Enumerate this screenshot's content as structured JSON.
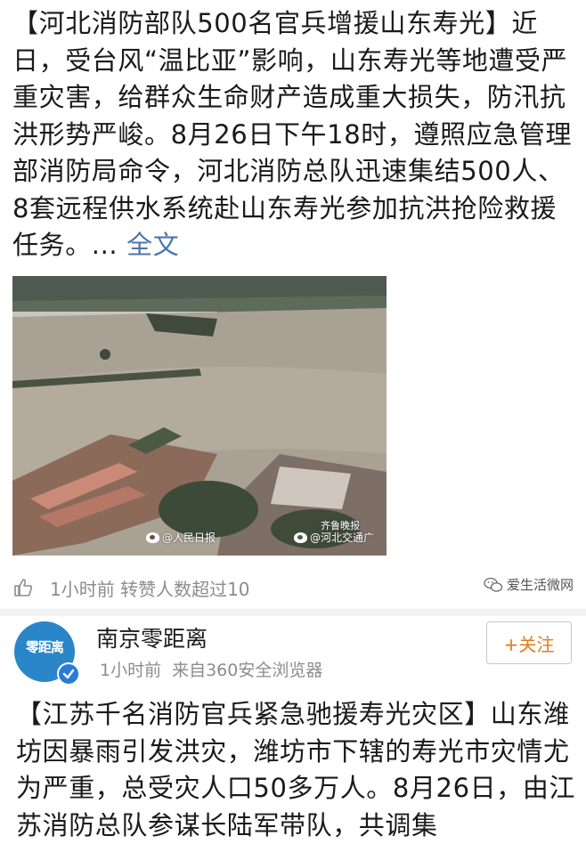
{
  "post1": {
    "text": "【河北消防部队500名官兵增援山东寿光】近日，受台风“温比亚”影响，山东寿光等地遭受严重灾害，给群众生命财产造成重大损失，防汛抗洪形势严峻。8月26日下午18时，遵照应急管理部消防局命令，河北消防总队迅速集结500人、8套远程供水系统赴山东寿光参加抗洪抢险救援任务。...",
    "full_text_link": "全文",
    "image_watermarks": [
      "@人民日报",
      "@河北交通广",
      "齐鲁晚报"
    ]
  },
  "stats": {
    "time_and_reposts": "1小时前 转赞人数超过10",
    "brand_watermark": "爱生活微网"
  },
  "post2": {
    "account_name": "南京零距离",
    "avatar_text": "零距离",
    "time": "1小时前",
    "source": "来自360安全浏览器",
    "follow_label": "+关注",
    "text": "【江苏千名消防官兵紧急驰援寿光灾区】山东潍坊因暴雨引发洪灾，潍坊市下辖的寿光市灾情尤为严重，总受灾人口50多万人。8月26日，由江苏消防总队参谋长陆军带队，共调集"
  },
  "colors": {
    "link": "#4a74b3",
    "follow_text": "#e07a1f",
    "meta_gray": "#8c8c8c",
    "avatar_blue": "#2a86c8"
  }
}
